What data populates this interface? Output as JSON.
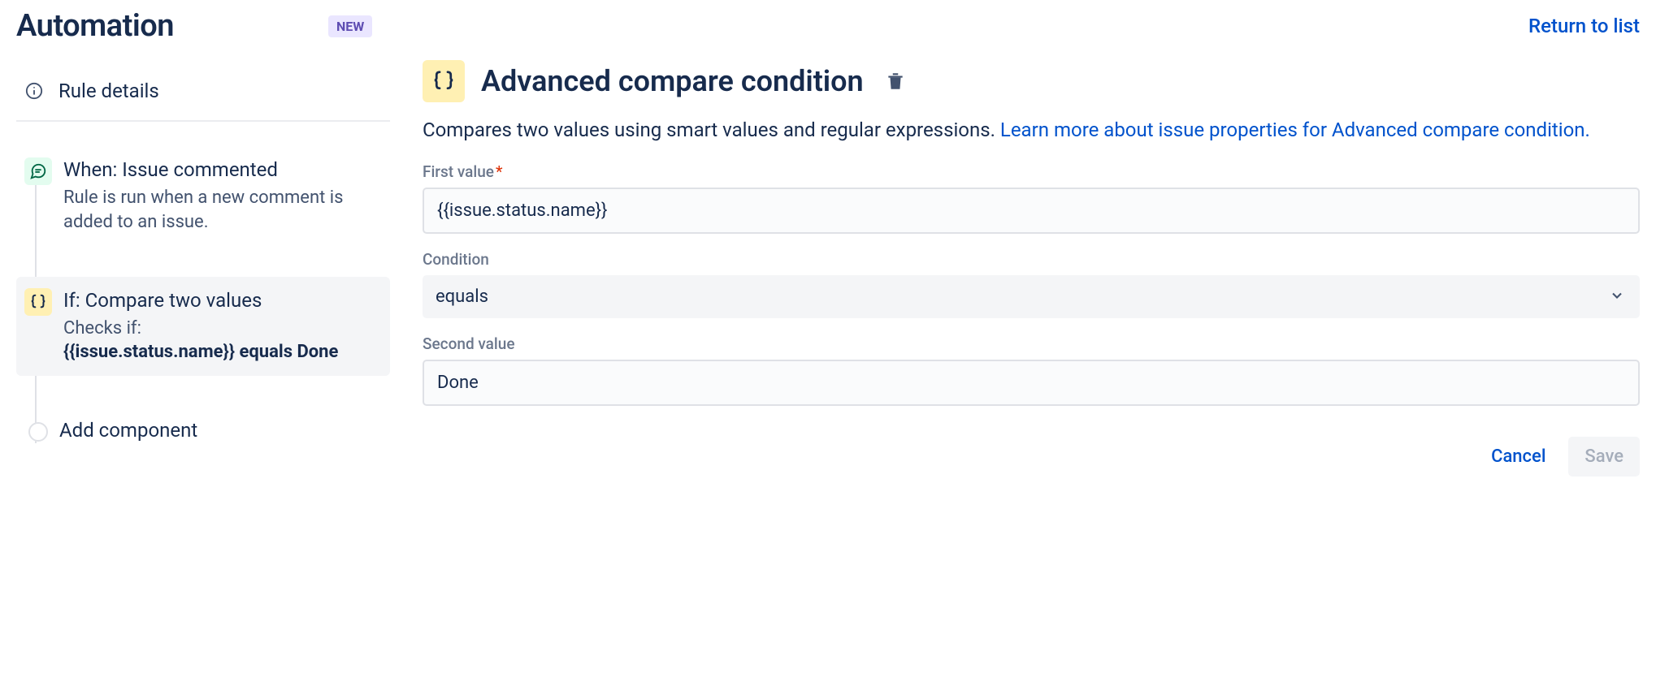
{
  "header": {
    "title": "Automation",
    "badge": "NEW",
    "return_link": "Return to list"
  },
  "sidebar": {
    "rule_details_label": "Rule details",
    "trigger": {
      "title": "When: Issue commented",
      "desc": "Rule is run when a new comment is added to an issue."
    },
    "condition": {
      "title": "If: Compare two values",
      "desc_prefix": "Checks if:",
      "desc_value": "{{issue.status.name}} equals Done"
    },
    "add_component": "Add component"
  },
  "main": {
    "title": "Advanced compare condition",
    "desc_text": "Compares two values using smart values and regular expressions. ",
    "desc_link": "Learn more about issue properties for Advanced compare condition.",
    "fields": {
      "first_value": {
        "label": "First value",
        "value": "{{issue.status.name}}"
      },
      "condition": {
        "label": "Condition",
        "value": "equals"
      },
      "second_value": {
        "label": "Second value",
        "value": "Done"
      }
    },
    "buttons": {
      "cancel": "Cancel",
      "save": "Save"
    }
  }
}
